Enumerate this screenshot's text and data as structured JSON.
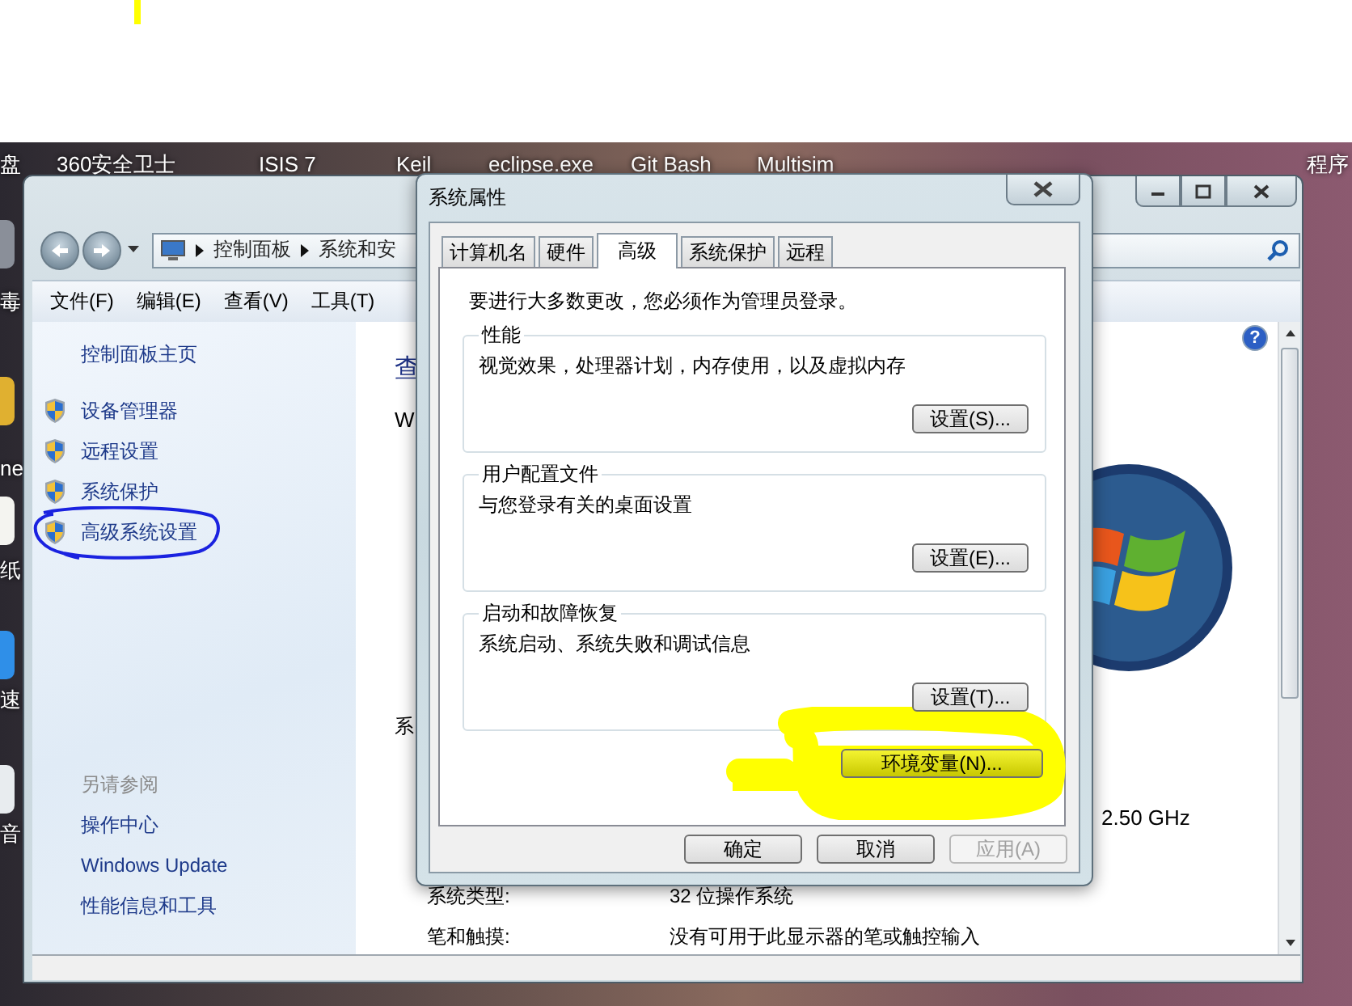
{
  "desktop": {
    "icon_labels": [
      {
        "label": "盘"
      },
      {
        "label": "360安全卫士"
      },
      {
        "label": "ISIS 7"
      },
      {
        "label": "Keil"
      },
      {
        "label": "eclipse.exe"
      },
      {
        "label": "Git Bash"
      },
      {
        "label": "Multisim"
      },
      {
        "label": "程序"
      }
    ],
    "edge_labels": [
      {
        "label": "毒"
      },
      {
        "label": "ne"
      },
      {
        "label": "纸"
      },
      {
        "label": "速"
      },
      {
        "label": "音"
      }
    ]
  },
  "explorer": {
    "breadcrumb": [
      "控制面板",
      "系统和安"
    ],
    "menu": [
      "文件(F)",
      "编辑(E)",
      "查看(V)",
      "工具(T)"
    ],
    "sidebar": {
      "home_link": "控制面板主页",
      "tasks": [
        {
          "label": "设备管理器",
          "circled": false
        },
        {
          "label": "远程设置",
          "circled": false
        },
        {
          "label": "系统保护",
          "circled": false
        },
        {
          "label": "高级系统设置",
          "circled": true
        }
      ],
      "see_also_title": "另请参阅",
      "see_also": [
        "操作中心",
        "Windows Update",
        "性能信息和工具"
      ]
    },
    "main": {
      "help_glyph": "?",
      "heading_fragment": "查",
      "subtitle_fragment": "W",
      "section_fragment": "系",
      "cpu_speed": "2.50 GHz",
      "specs": [
        {
          "label": "系统类型:",
          "value": "32 位操作系统"
        },
        {
          "label": "笔和触摸:",
          "value": "没有可用于此显示器的笔或触控输入"
        }
      ]
    }
  },
  "dialog": {
    "title": "系统属性",
    "tabs": [
      {
        "label": "计算机名",
        "selected": false
      },
      {
        "label": "硬件",
        "selected": false
      },
      {
        "label": "高级",
        "selected": true
      },
      {
        "label": "系统保护",
        "selected": false
      },
      {
        "label": "远程",
        "selected": false
      }
    ],
    "notice": "要进行大多数更改，您必须作为管理员登录。",
    "groups": [
      {
        "title": "性能",
        "description": "视觉效果，处理器计划，内存使用，以及虚拟内存",
        "button": "设置(S)..."
      },
      {
        "title": "用户配置文件",
        "description": "与您登录有关的桌面设置",
        "button": "设置(E)..."
      },
      {
        "title": "启动和故障恢复",
        "description": "系统启动、系统失败和调试信息",
        "button": "设置(T)..."
      }
    ],
    "env_button": {
      "label": "环境变量(N)...",
      "highlighted": true
    },
    "buttons": [
      {
        "label": "确定",
        "disabled": false
      },
      {
        "label": "取消",
        "disabled": false
      },
      {
        "label": "应用(A)",
        "disabled": true
      }
    ]
  }
}
